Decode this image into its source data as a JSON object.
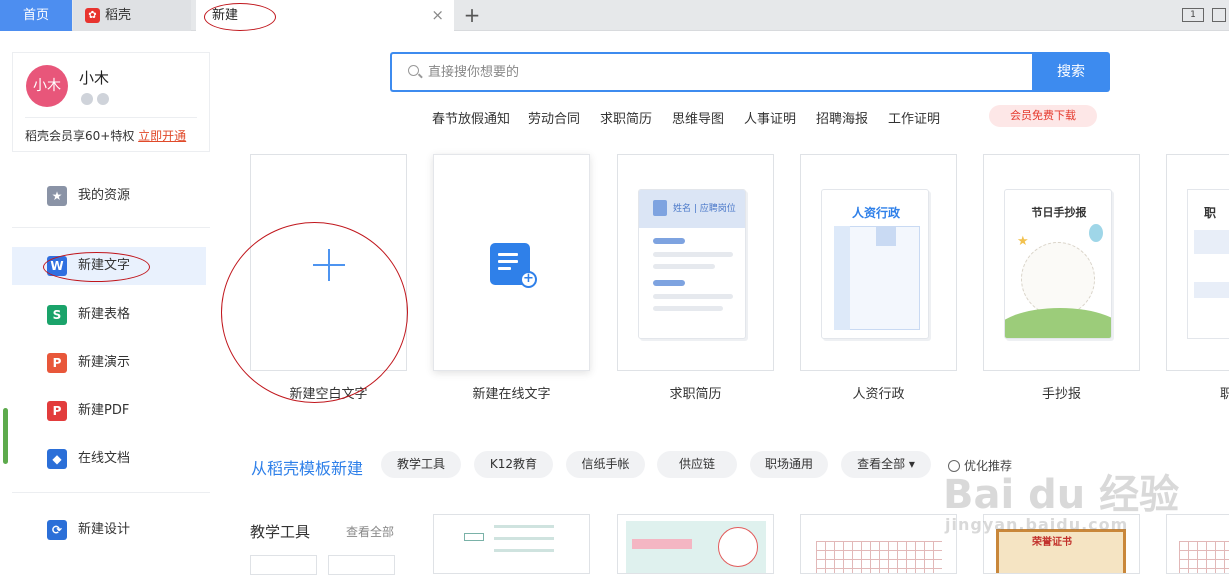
{
  "tabs": {
    "home": "首页",
    "daoke": "稻壳",
    "new": "新建",
    "close": "×",
    "add": "+"
  },
  "profile": {
    "avatar_text": "小木",
    "username": "小木",
    "vip_text": "稻壳会员享60+特权",
    "vip_link": "立即开通"
  },
  "sidebar": {
    "items": [
      {
        "label": "我的资源",
        "icon": "star-icon",
        "color": "#8a93a6"
      },
      {
        "label": "新建文字",
        "icon": "word-icon",
        "color": "#2f6fe0"
      },
      {
        "label": "新建表格",
        "icon": "sheet-icon",
        "color": "#1aa36a"
      },
      {
        "label": "新建演示",
        "icon": "ppt-icon",
        "color": "#e8573a"
      },
      {
        "label": "新建PDF",
        "icon": "pdf-icon",
        "color": "#e23c3c"
      },
      {
        "label": "在线文档",
        "icon": "cloud-doc-icon",
        "color": "#2b6fd8"
      },
      {
        "label": "新建设计",
        "icon": "design-icon",
        "color": "#2b6fd8"
      }
    ]
  },
  "search": {
    "placeholder": "直接搜你想要的",
    "button": "搜索"
  },
  "hot_tags": [
    "春节放假通知",
    "劳动合同",
    "求职简历",
    "思维导图",
    "人事证明",
    "招聘海报",
    "工作证明"
  ],
  "vip_download": "会员免费下载",
  "cards": [
    {
      "label": "新建空白文字"
    },
    {
      "label": "新建在线文字"
    },
    {
      "label": "求职简历",
      "thumb_text": "姓名 | 应聘岗位"
    },
    {
      "label": "人资行政",
      "thumb_text": "人资行政"
    },
    {
      "label": "手抄报",
      "thumb_text": "节日手抄报"
    },
    {
      "label": "职",
      "thumb_text": "职"
    }
  ],
  "templates": {
    "title": "从稻壳模板新建",
    "chips": [
      "教学工具",
      "K12教育",
      "信纸手帐",
      "供应链",
      "职场通用",
      "查看全部 ▾"
    ],
    "recommend": "优化推荐"
  },
  "section": {
    "title": "教学工具",
    "view_all": "查看全部",
    "thumbs": [
      "思维导图",
      "小报",
      "作文纸",
      "荣誉证书"
    ]
  },
  "window": {
    "btn1": "1"
  },
  "watermark": {
    "brand": "Bai du 经验",
    "url": "jingyan.baidu.com"
  }
}
